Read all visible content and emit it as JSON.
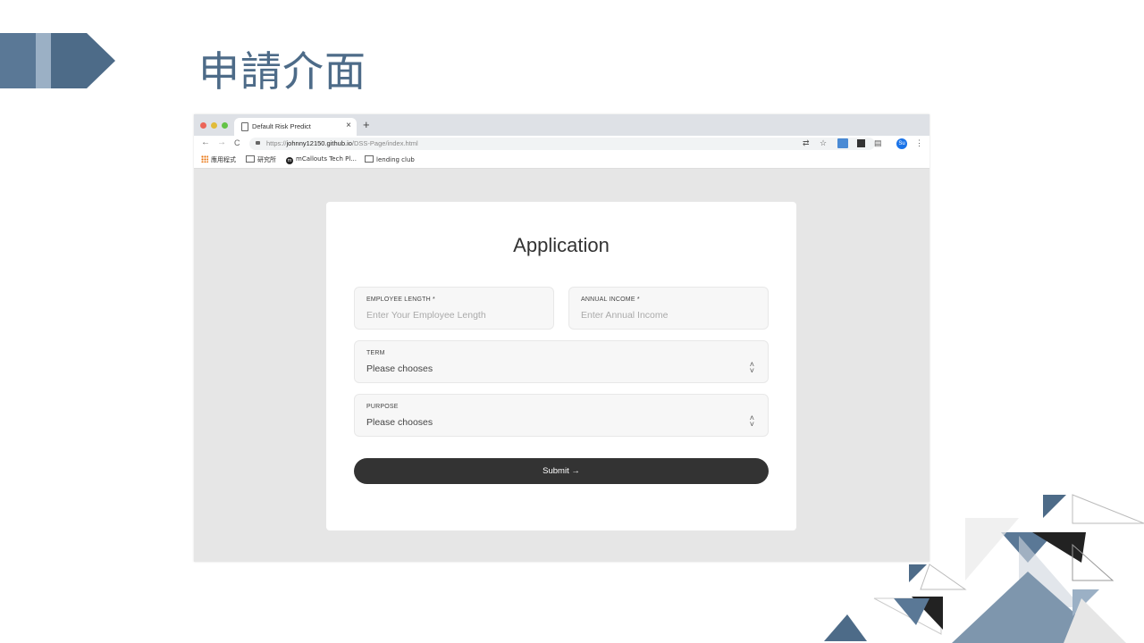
{
  "slide": {
    "title": "申請介面"
  },
  "browser": {
    "tab_title": "Default Risk Predict",
    "tab_close": "×",
    "new_tab": "+",
    "nav": {
      "back": "←",
      "forward": "→",
      "reload": "C"
    },
    "url": {
      "prefix": "https://",
      "host": "johnny12150.github.io",
      "path": "/DSS-Page/index.html"
    },
    "profile": "Su",
    "bookmarks": [
      {
        "label": "應用程式"
      },
      {
        "label": "研究所"
      },
      {
        "label": "mCallouts Tech Pl..."
      },
      {
        "label": "lending club"
      }
    ]
  },
  "form": {
    "title": "Application",
    "employee_length": {
      "label": "EMPLOYEE LENGTH *",
      "placeholder": "Enter Your Employee Length"
    },
    "annual_income": {
      "label": "ANNUAL INCOME *",
      "placeholder": "Enter Annual Income"
    },
    "term": {
      "label": "TERM",
      "value": "Please chooses"
    },
    "purpose": {
      "label": "PURPOSE",
      "value": "Please chooses"
    },
    "submit": "Submit →"
  },
  "colors": {
    "accent": "#4d6b88",
    "button": "#333333"
  }
}
